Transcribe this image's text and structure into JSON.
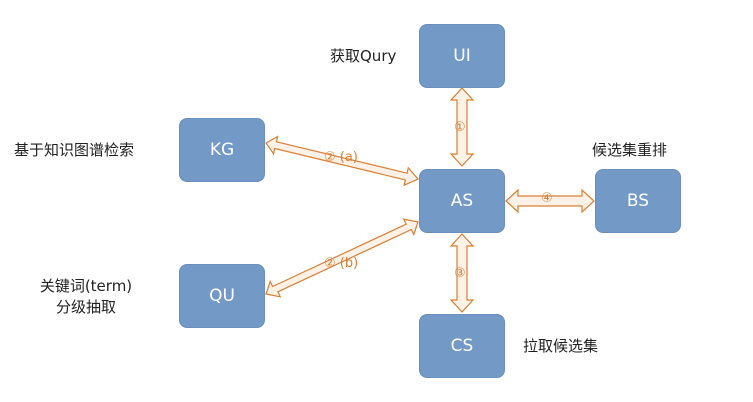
{
  "nodes": {
    "ui": "UI",
    "kg": "KG",
    "as": "AS",
    "bs": "BS",
    "qu": "QU",
    "cs": "CS"
  },
  "labels": {
    "ui": "获取Qury",
    "kg": "基于知识图谱检索",
    "bs": "候选集重排",
    "qu_line1": "关键词(term)",
    "qu_line2": "分级抽取",
    "cs": "拉取候选集"
  },
  "edges": {
    "ui_as": "①",
    "kg_as": "② (a)",
    "qu_as": "② (b)",
    "cs_as": "③",
    "as_bs": "④"
  },
  "colors": {
    "node_fill": "#7399c6",
    "arrow_stroke": "#d97f33",
    "arrow_fill": "#fdf1e8"
  }
}
